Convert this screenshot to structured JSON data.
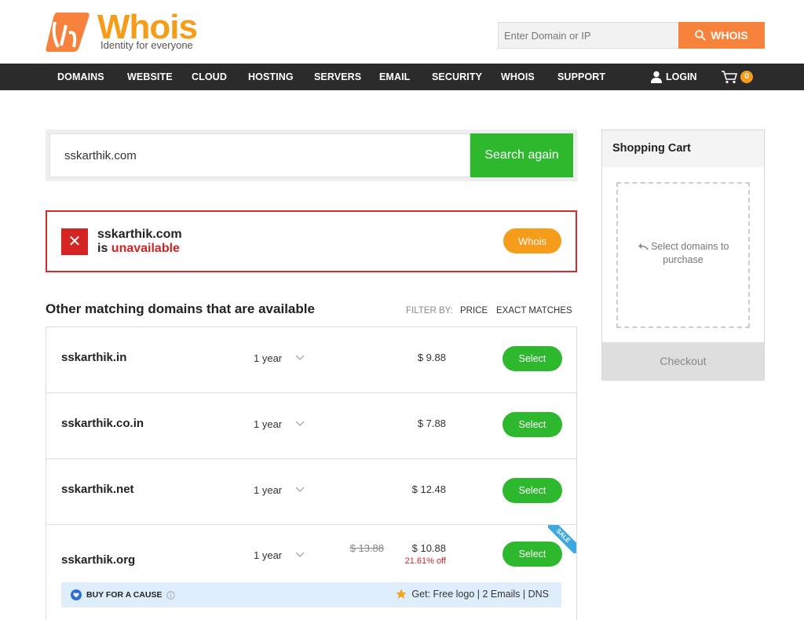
{
  "brand": {
    "name": "Whois",
    "tagline": "Identity for everyone",
    "colors": {
      "orange": "#f59c1a",
      "green": "#2eb82e",
      "red": "#d42424",
      "nav": "#2b2b2b"
    }
  },
  "header_search": {
    "placeholder": "Enter Domain or IP",
    "button_label": "WHOIS",
    "button_icon": "search-icon"
  },
  "nav": {
    "items": [
      "DOMAINS",
      "WEBSITE",
      "CLOUD",
      "HOSTING",
      "SERVERS",
      "EMAIL",
      "SECURITY",
      "WHOIS",
      "SUPPORT"
    ],
    "login_label": "LOGIN",
    "cart_count": "0"
  },
  "search": {
    "value": "sskarthik.com",
    "button_label": "Search again"
  },
  "unavailable": {
    "domain": "sskarthik.com",
    "prefix": "is ",
    "status": "unavailable",
    "whois_label": "Whois"
  },
  "results": {
    "title": "Other matching domains that are available",
    "filter_label": "FILTER BY:",
    "filter_price": "PRICE",
    "filter_exact": "EXACT MATCHES",
    "select_label": "Select",
    "rows": [
      {
        "domain": "sskarthik.in",
        "term": "1 year",
        "price": "$ 9.88"
      },
      {
        "domain": "sskarthik.co.in",
        "term": "1 year",
        "price": "$ 7.88"
      },
      {
        "domain": "sskarthik.net",
        "term": "1 year",
        "price": "$ 12.48"
      }
    ],
    "sale_row": {
      "domain": "sskarthik.org",
      "term": "1 year",
      "old_price": "$ 13.88",
      "price": "$ 10.88",
      "discount": "21.61% off",
      "ribbon": "SALE",
      "cause_label": "BUY FOR A CAUSE",
      "cause_perks": "Get: Free logo | 2 Emails | DNS"
    }
  },
  "cart": {
    "title": "Shopping Cart",
    "hint": "Select domains to purchase",
    "checkout_label": "Checkout"
  }
}
